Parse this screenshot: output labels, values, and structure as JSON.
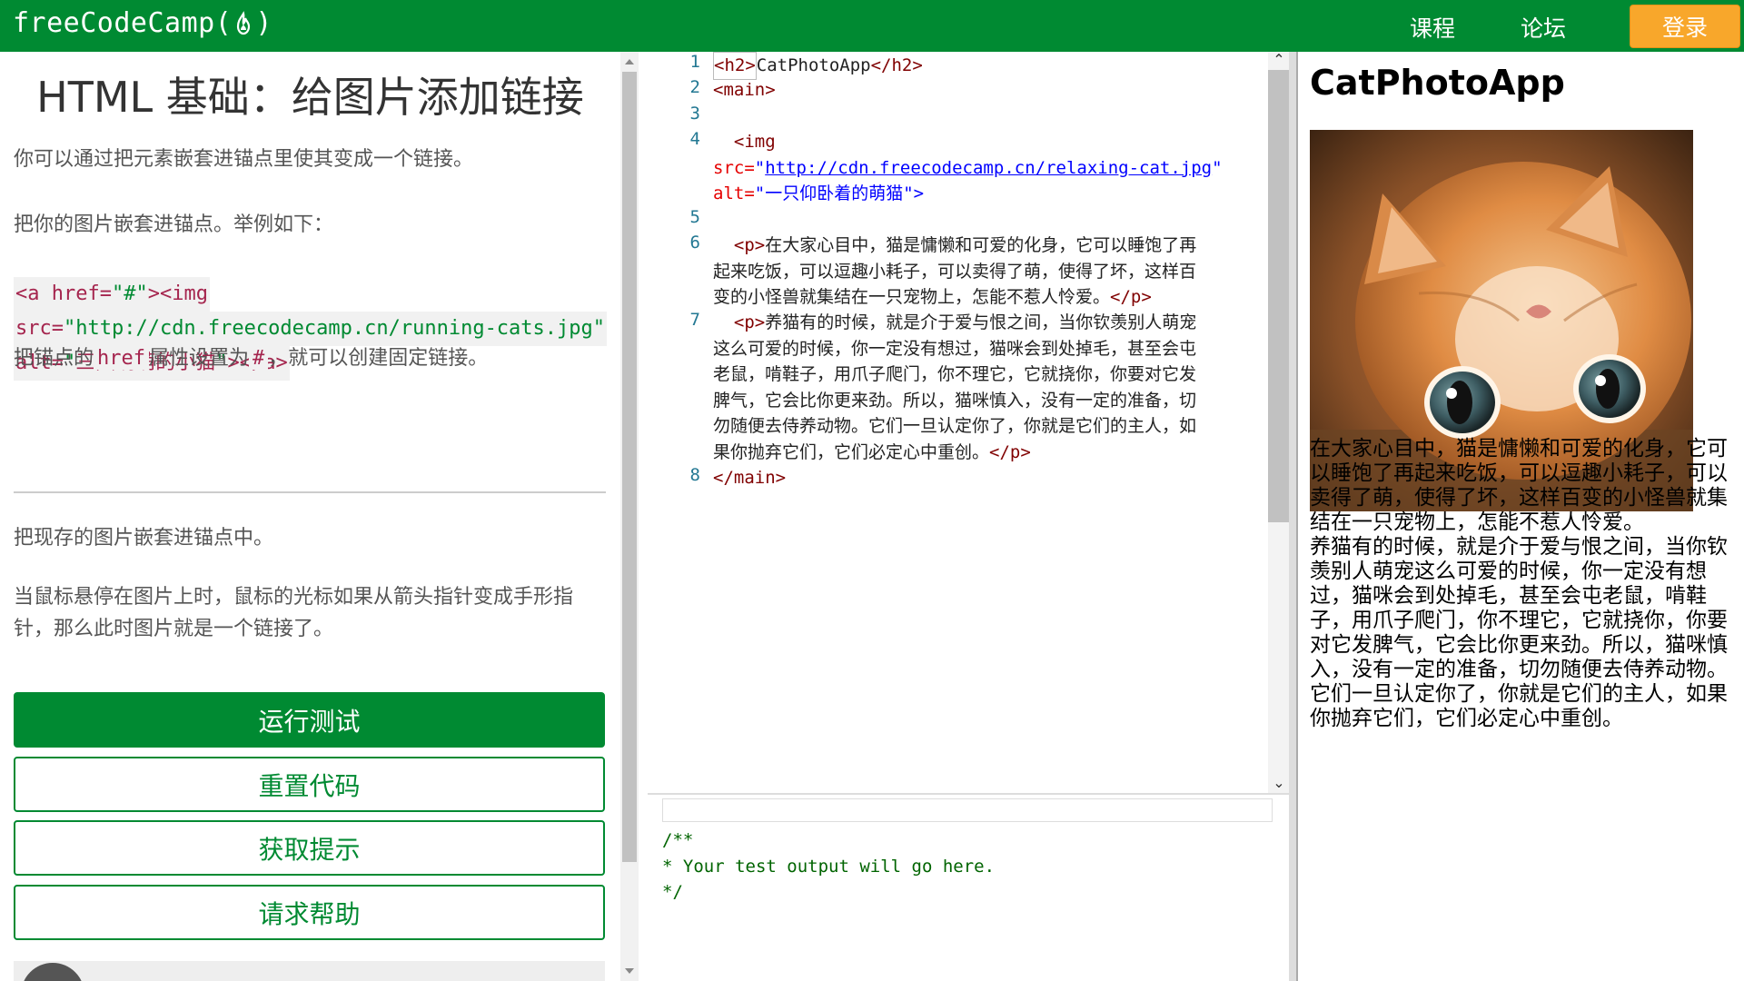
{
  "navbar": {
    "brand_left": "freeCodeCamp(",
    "brand_right": ")",
    "links": [
      "课程",
      "论坛"
    ],
    "login": "登录",
    "color": "#008a32",
    "login_color": "#f8a72b"
  },
  "lesson": {
    "title": "HTML 基础：给图片添加链接",
    "intro": "你可以通过把元素嵌套进锚点里使其变成一个链接。",
    "example_intro": "把你的图片嵌套进锚点。举例如下：",
    "example_code": {
      "line1_tag": "<a href=",
      "line1_str": "\"#\"",
      "line1_tag2": "><img",
      "line2_attr": "src=",
      "line2_str": "\"http://cdn.freecodecamp.cn/running-cats.jpg\"",
      "line3_attr": "alt=",
      "line3_q1": "\"",
      "line3_txt": "三只萌萌的小猫",
      "line3_q2": "\"",
      "line3_end": "></a>"
    },
    "href_note_before": "把锚点的",
    "href_note_code": "href",
    "href_note_mid": "属性设置为",
    "href_note_hash": "#",
    "href_note_after": "，就可以创建固定链接。",
    "task": "把现存的图片嵌套进锚点中。",
    "hover_note": "当鼠标悬停在图片上时，鼠标的光标如果从箭头指针变成手形指针，那么此时图片就是一个链接了。"
  },
  "buttons": {
    "run": "运行测试",
    "reset": "重置代码",
    "hint": "获取提示",
    "help": "请求帮助"
  },
  "editor": {
    "line_numbers": [
      "1",
      "2",
      "3",
      "4",
      "5",
      "6",
      "7",
      "8"
    ],
    "l1_open": "<h2>",
    "l1_text": "CatPhotoApp",
    "l1_close": "</h2>",
    "l2": "<main>",
    "l4_tag": "<img",
    "l4_src_attr": "src=",
    "l4_src_q1": "\"",
    "l4_src_url": "http://cdn.freecodecamp.cn/relaxing-cat.jpg",
    "l4_src_q2": "\"",
    "l4_alt_attr": "alt=",
    "l4_alt_q1": "\"",
    "l4_alt_txt": "一只仰卧着的萌猫",
    "l4_alt_q2": "\">",
    "l6_open": "<p>",
    "l6_a": "在大家心目中，猫是慵懒和可爱的化身，它可以睡饱了再",
    "l6_b": "起来吃饭，可以逗趣小耗子，可以卖得了萌，使得了坏，这样百",
    "l6_c": "变的小怪兽就集结在一只宠物上，怎能不惹人怜爱。",
    "l6_close": "</p>",
    "l7_open": "<p>",
    "l7_a": "养猫有的时候，就是介于爱与恨之间，当你钦羡别人萌宠",
    "l7_b": "这么可爱的时候，你一定没有想过，猫咪会到处掉毛，甚至会屯",
    "l7_c": "老鼠，啃鞋子，用爪子爬门，你不理它，它就挠你，你要对它发",
    "l7_d": "脾气，它会比你更来劲。所以，猫咪慎入，没有一定的准备，切",
    "l7_e": "勿随便去侍养动物。它们一旦认定你了，你就是它们的主人，如",
    "l7_f": "果你抛弃它们，它们必定心中重创。",
    "l7_close": "</p>",
    "l8": "</main>"
  },
  "output": {
    "text": "/**\n* Your test output will go here.\n*/"
  },
  "preview": {
    "title": "CatPhotoApp",
    "p1": "在大家心目中，猫是慵懒和可爱的化身，它可以睡饱了再起来吃饭，可以逗趣小耗子，可以卖得了萌，使得了坏，这样百变的小怪兽就集结在一只宠物上，怎能不惹人怜爱。",
    "p2": "养猫有的时候，就是介于爱与恨之间，当你钦羡别人萌宠这么可爱的时候，你一定没有想过，猫咪会到处掉毛，甚至会屯老鼠，啃鞋子，用爪子爬门，你不理它，它就挠你，你要对它发脾气，它会比你更来劲。所以，猫咪慎入，没有一定的准备，切勿随便去侍养动物。它们一旦认定你了，你就是它们的主人，如果你抛弃它们，它们必定心中重创。"
  }
}
